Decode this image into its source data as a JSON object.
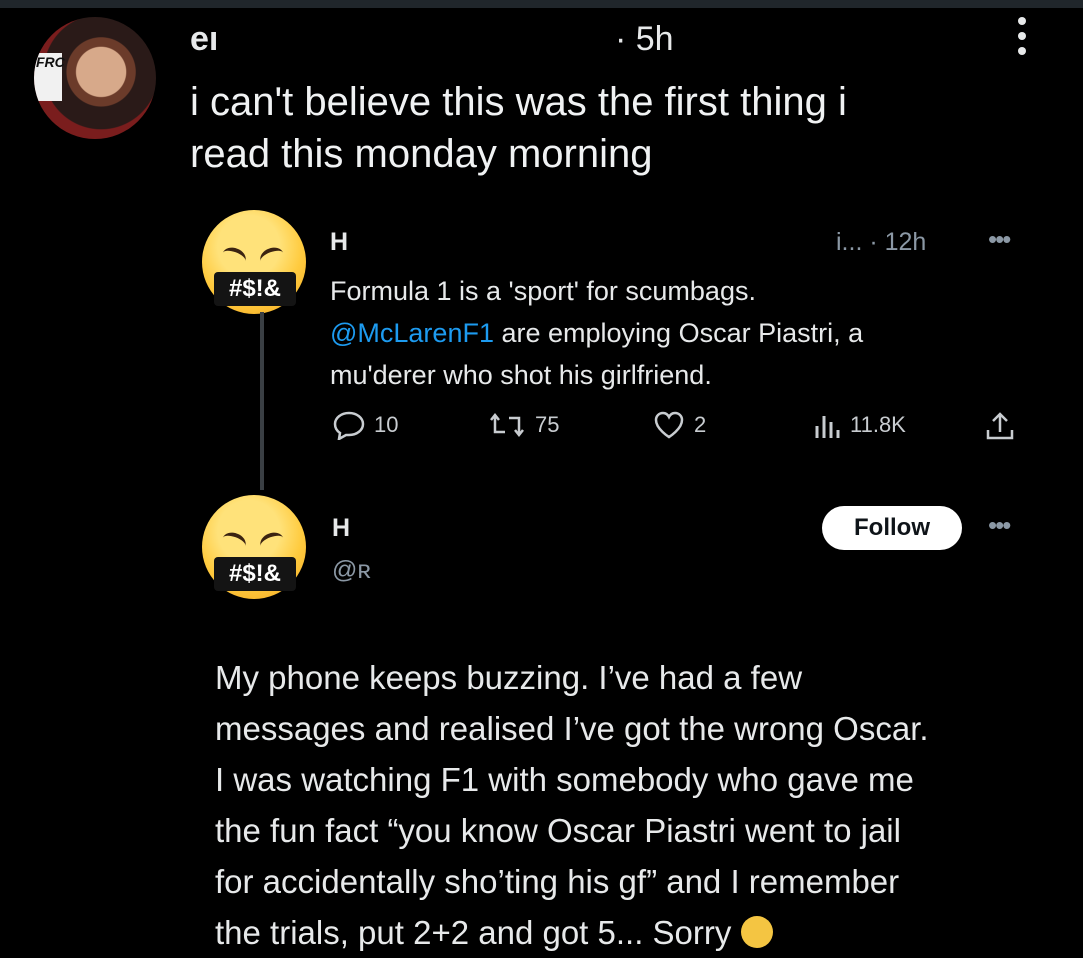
{
  "post": {
    "author_name": "eı",
    "time": "· 5h",
    "text_line1": "i can't believe this was the first thing i",
    "text_line2": "read this monday morning",
    "avatar_logo": "FRC"
  },
  "quoted": {
    "author_name": "H",
    "handle_time": "i... · 12h",
    "text_line1": "Formula 1 is a 'sport' for scumbags.",
    "mention": "@McLarenF1",
    "text_line2_rest": " are employing Oscar Piastri, a",
    "text_line3": "mu'derer who shot his girlfriend.",
    "emoji_tag": "#$!&",
    "metrics": {
      "replies": "10",
      "reposts": "75",
      "likes": "2",
      "views": "11.8K"
    }
  },
  "reply": {
    "author_name": "H",
    "handle": "@ʀ",
    "follow_label": "Follow",
    "emoji_tag": "#$!&",
    "lines": [
      "My phone keeps buzzing. I’ve had a few",
      "messages and realised I’ve got the wrong Oscar.",
      "I was watching F1 with somebody who gave me",
      "the fun fact “you know Oscar Piastri went to jail",
      "for accidentally sho’ting his gf” and I remember",
      "the trials, put 2+2 and got 5... Sorry"
    ]
  },
  "colors": {
    "background": "#000000",
    "text": "#e7e9ea",
    "secondary": "#8b98a5",
    "link": "#1d9bf0",
    "follow_button": "#ffffff"
  }
}
